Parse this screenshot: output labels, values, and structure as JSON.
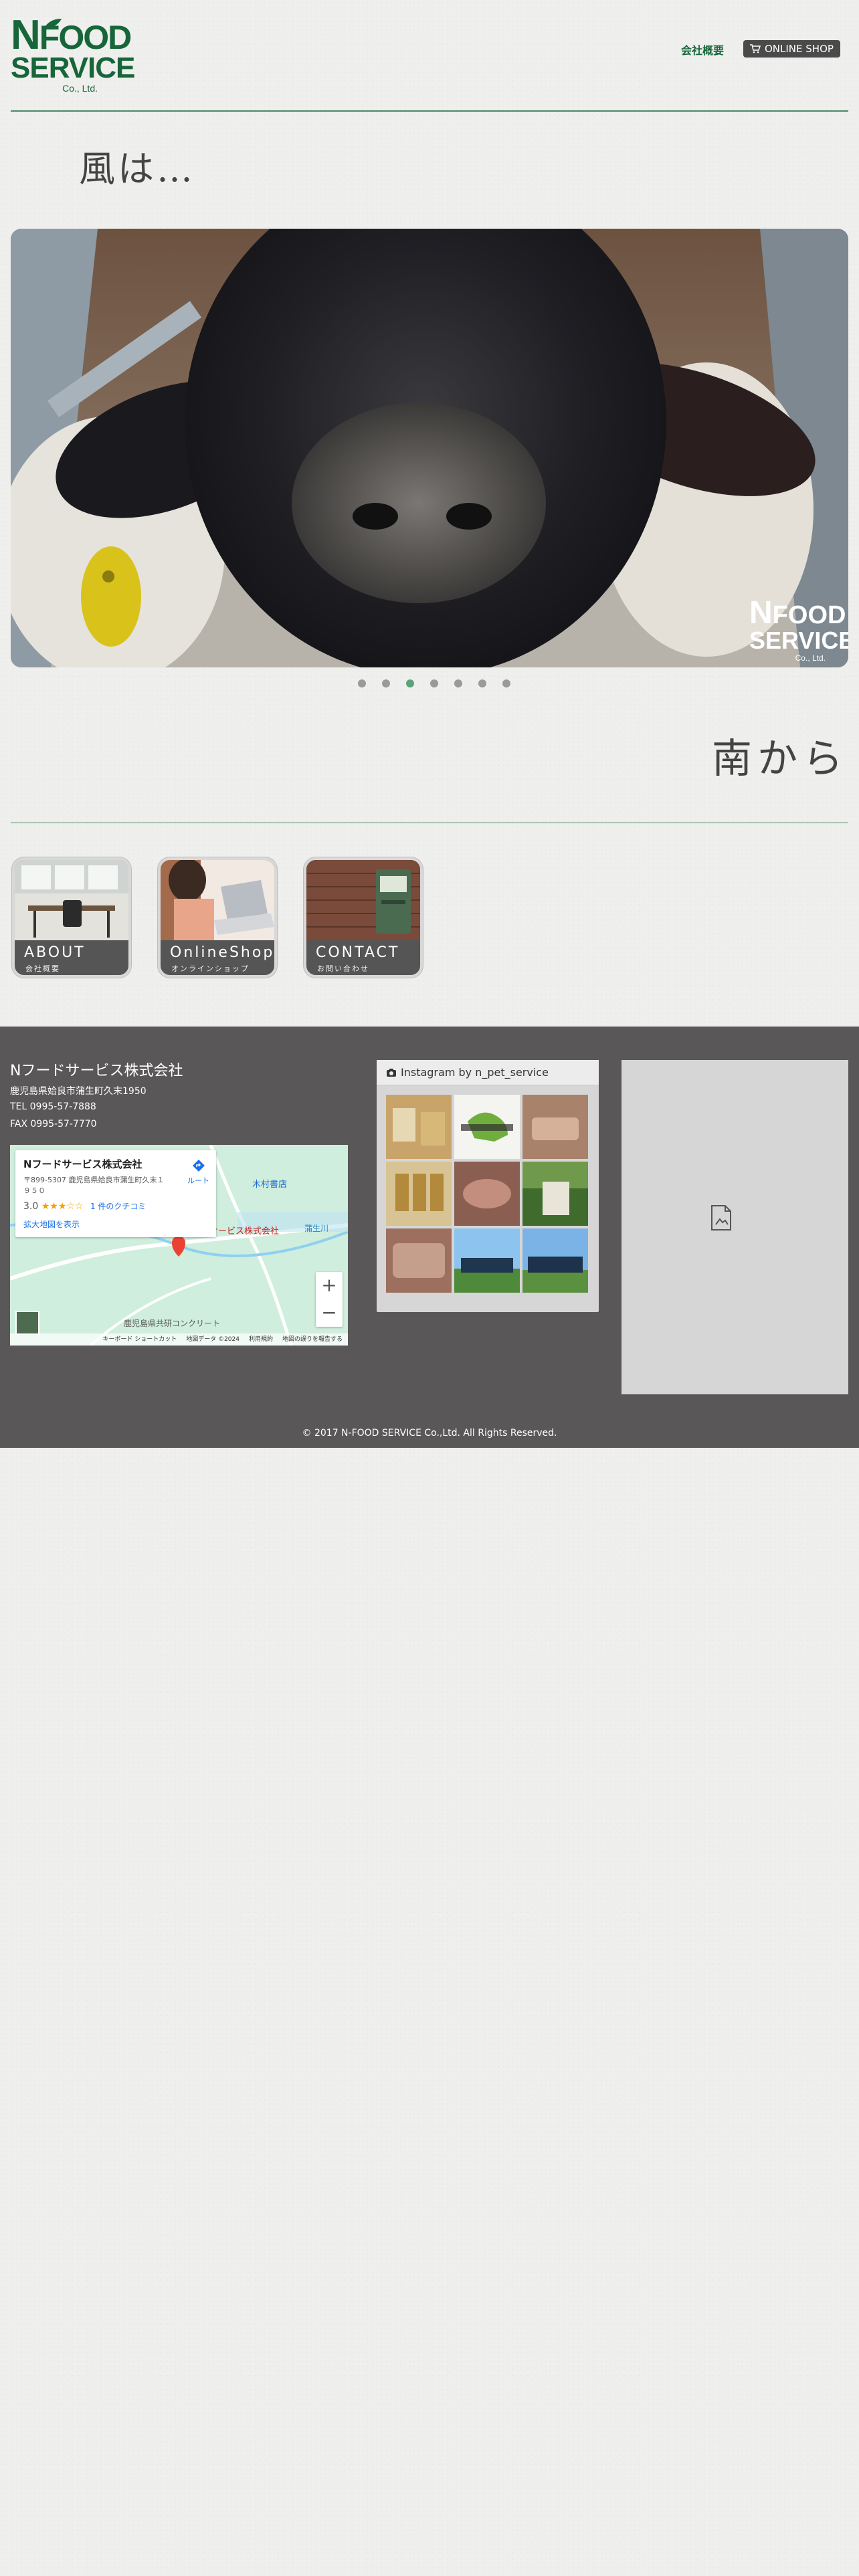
{
  "header": {
    "logo": {
      "line1_big": "N",
      "line1_rest": "FOOD",
      "line2": "SERVICE",
      "line3": "Co., Ltd."
    },
    "nav_company": "会社概要",
    "nav_shop": "ONLINE SHOP"
  },
  "hero": {
    "text_top": "風は…",
    "text_bottom": "南から",
    "slider_logo": {
      "line1_big": "N",
      "line1_rest": "FOOD",
      "line2": "SERVICE",
      "line3": "Co., Ltd."
    },
    "slide_count": 7,
    "active_slide": 3
  },
  "tiles": [
    {
      "title": "ABOUT",
      "subtitle": "会社概要"
    },
    {
      "title": "OnlineShop",
      "subtitle": "オンラインショップ"
    },
    {
      "title": "CONTACT",
      "subtitle": "お問い合わせ"
    }
  ],
  "footer": {
    "company": "Nフードサービス株式会社",
    "address": "鹿児島県姶良市蒲生町久末1950",
    "tel": "TEL 0995-57-7888",
    "fax": "FAX 0995-57-7770",
    "map": {
      "name": "Nフードサービス株式会社",
      "address": "〒899-5307 鹿児島県姶良市蒲生町久末１９５０",
      "rating": "3.0",
      "stars": "★★★☆☆",
      "reviews": "1 件のクチコミ",
      "larger_map": "拡大地図を表示",
      "route": "ルート",
      "label_pin": "ードサービス株式会社",
      "label_shop": "木村書店",
      "label_river": "蒲生川",
      "label_course": "鹿児島県共研コンクリート",
      "zoom_in": "+",
      "zoom_out": "−",
      "footer_items": [
        "キーボード ショートカット",
        "地図データ ©2024",
        "利用規約",
        "地図の誤りを報告する"
      ]
    },
    "instagram": {
      "title": "Instagram by n_pet_service"
    },
    "copyright": "© 2017 N-FOOD SERVICE Co.,Ltd. All Rights Reserved."
  },
  "colors": {
    "brand_green": "#17663a",
    "footer_bg": "#595757",
    "active_dot": "#5aa27a"
  }
}
